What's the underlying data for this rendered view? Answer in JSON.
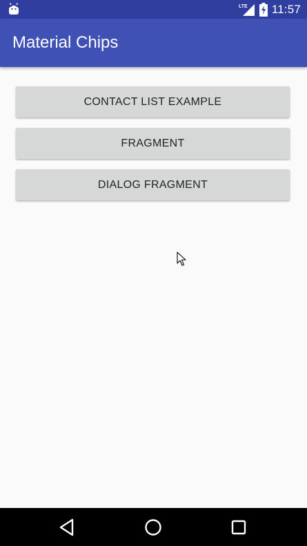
{
  "status_bar": {
    "network_label": "LTE",
    "time": "11:57",
    "icons": [
      "android-notification-icon",
      "lte-signal-icon",
      "battery-charging-icon"
    ]
  },
  "app_bar": {
    "title": "Material Chips"
  },
  "buttons": [
    {
      "label": "CONTACT LIST EXAMPLE"
    },
    {
      "label": "FRAGMENT"
    },
    {
      "label": "DIALOG FRAGMENT"
    }
  ],
  "nav_bar": {
    "icons": [
      "back-icon",
      "home-icon",
      "recents-icon"
    ]
  },
  "colors": {
    "status_bar": "#303f9f",
    "app_bar": "#3f51b5",
    "background": "#fafafa",
    "button": "#d6d7d7",
    "nav_bar": "#000000"
  }
}
